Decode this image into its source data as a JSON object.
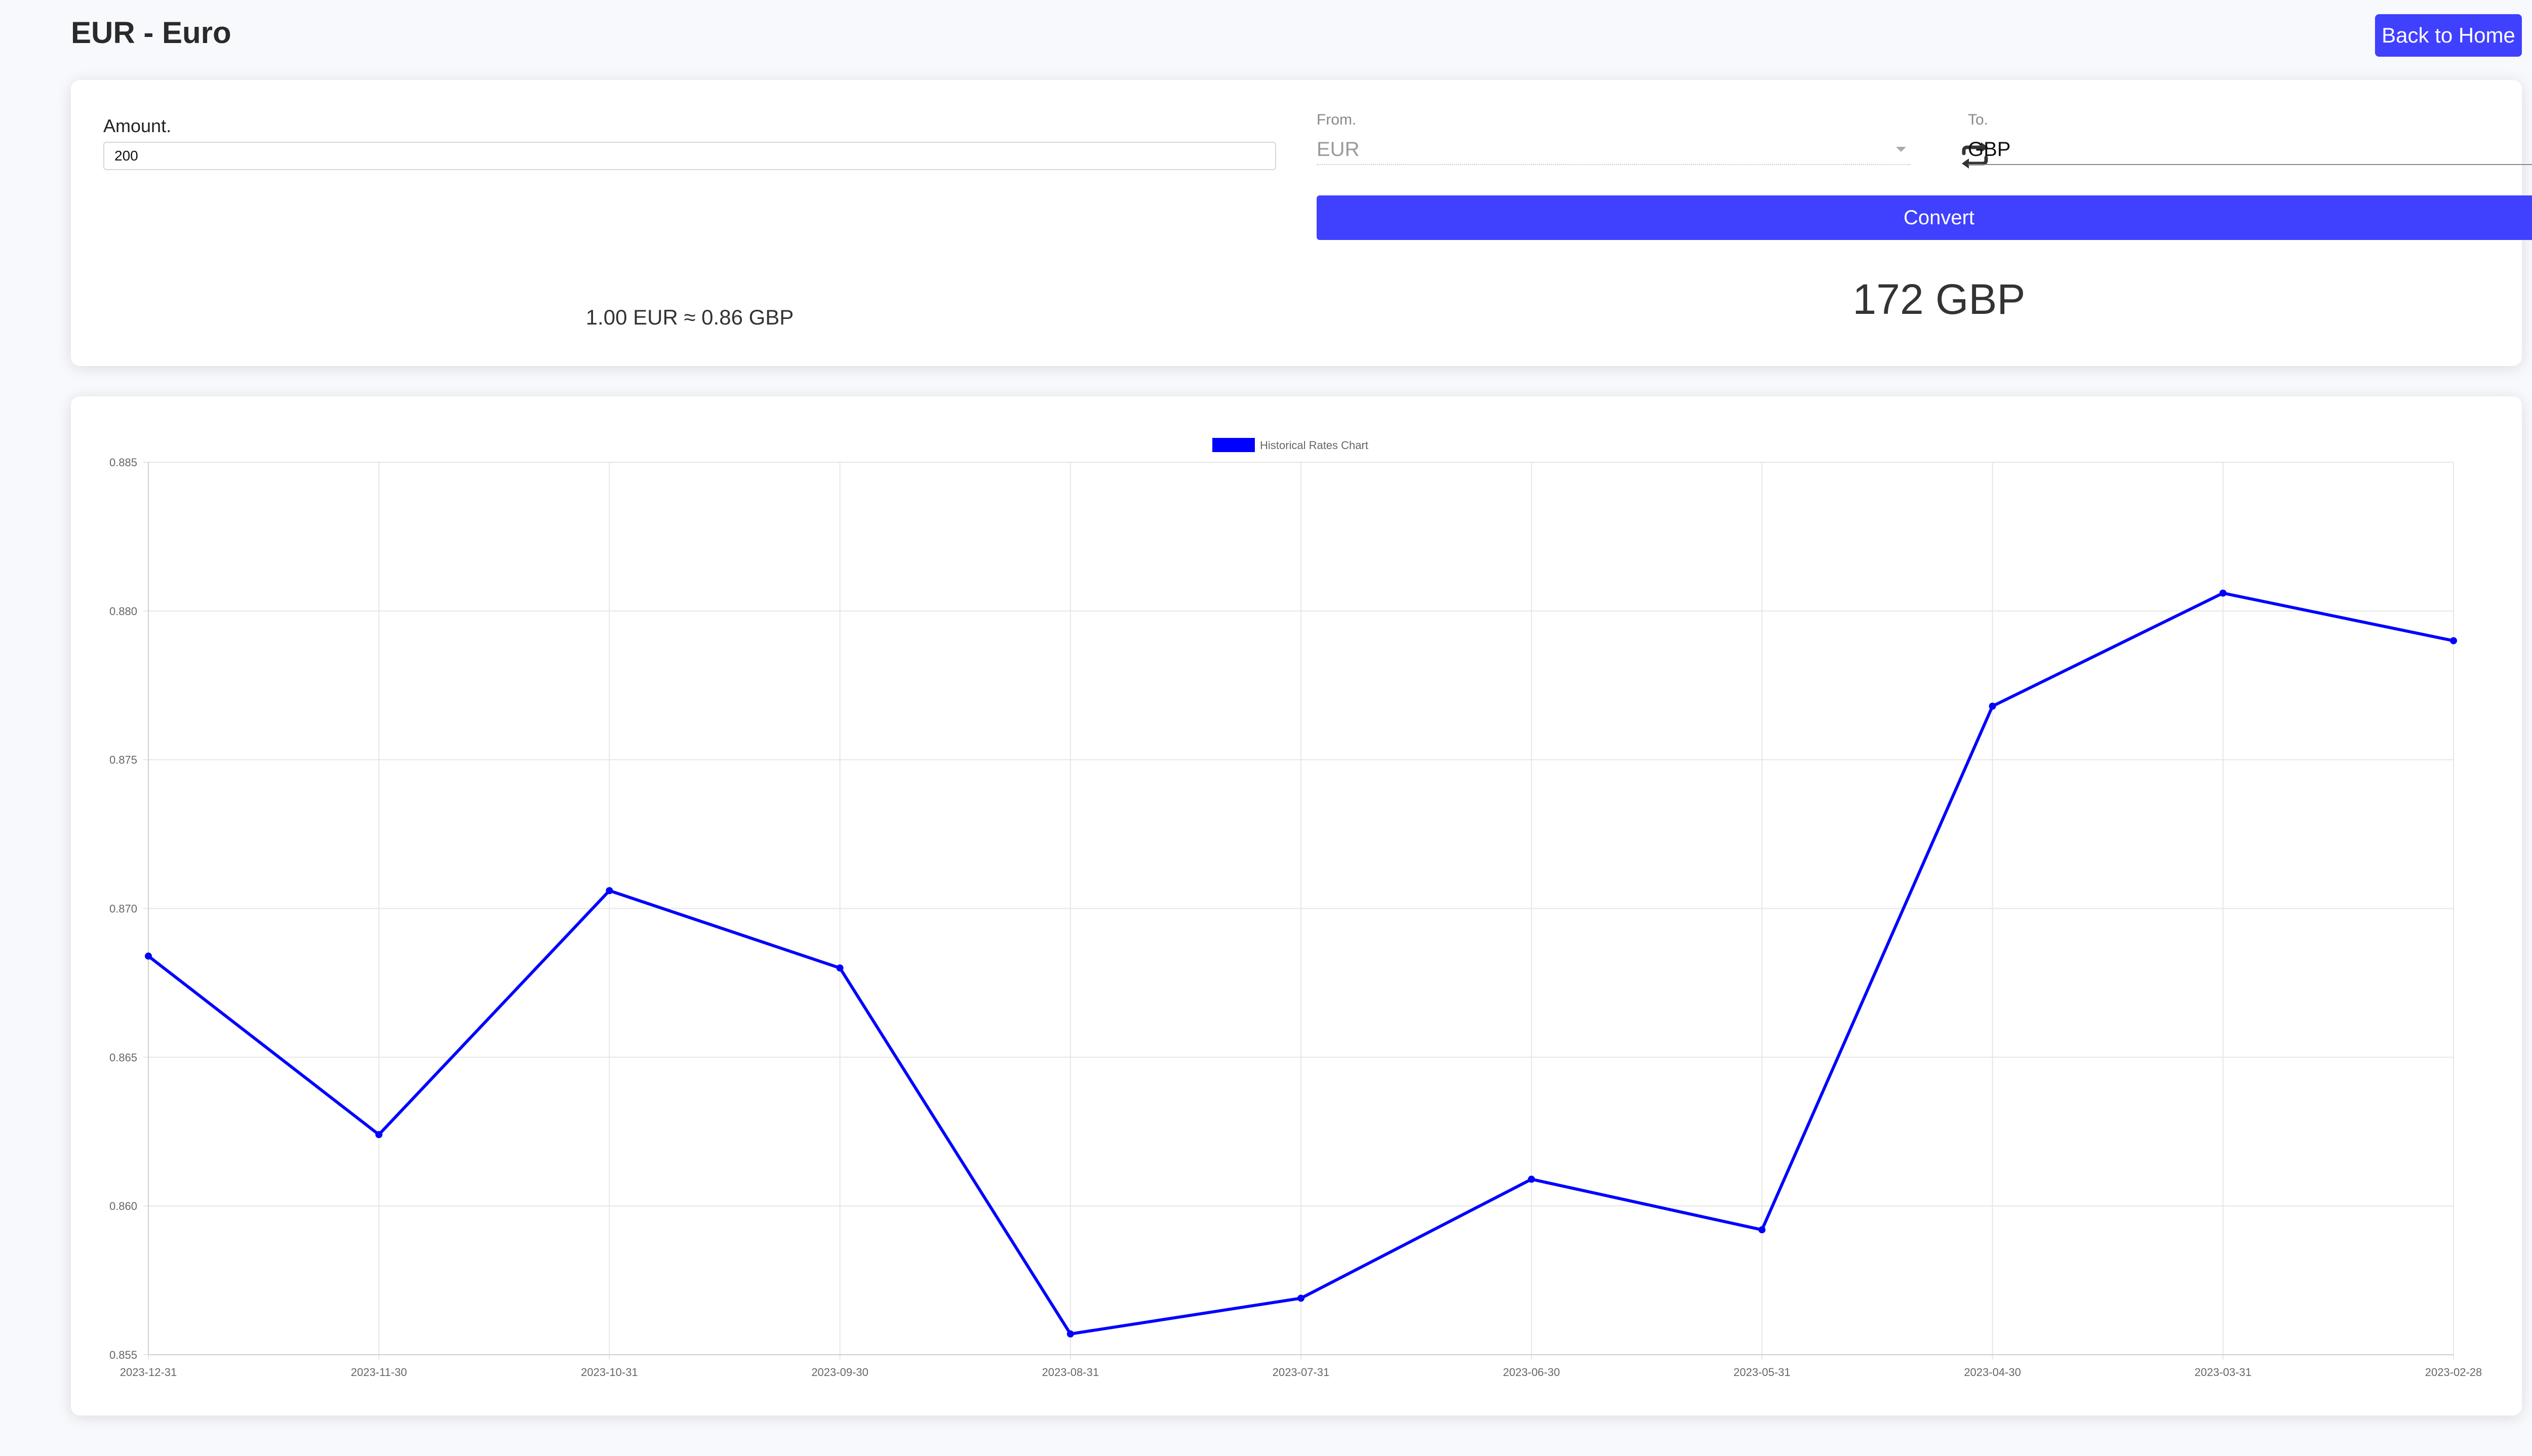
{
  "header": {
    "title": "EUR - Euro",
    "back_label": "Back to Home"
  },
  "converter": {
    "amount_label": "Amount.",
    "amount_value": "200",
    "from_label": "From.",
    "from_value": "EUR",
    "to_label": "To.",
    "to_value": "GBP",
    "convert_label": "Convert",
    "rate_text": "1.00 EUR ≈ 0.86 GBP",
    "result_text": "172 GBP"
  },
  "colors": {
    "accent": "#4040ff",
    "line": "#0000ff"
  },
  "icons": {
    "swap": "swap-arrows-icon"
  },
  "chart_data": {
    "type": "line",
    "legend": "Historical Rates Chart",
    "legend_position": "top-center",
    "grid": true,
    "x": [
      "2023-12-31",
      "2023-11-30",
      "2023-10-31",
      "2023-09-30",
      "2023-08-31",
      "2023-07-31",
      "2023-06-30",
      "2023-05-31",
      "2023-04-30",
      "2023-03-31",
      "2023-02-28"
    ],
    "series": [
      {
        "name": "Historical Rates Chart",
        "values": [
          0.8684,
          0.8624,
          0.8706,
          0.868,
          0.8557,
          0.8569,
          0.8609,
          0.8592,
          0.8768,
          0.8806,
          0.879
        ]
      }
    ],
    "ylim": [
      0.855,
      0.885
    ],
    "yticks": [
      "0.885",
      "0.880",
      "0.875",
      "0.870",
      "0.865",
      "0.860",
      "0.855"
    ]
  }
}
